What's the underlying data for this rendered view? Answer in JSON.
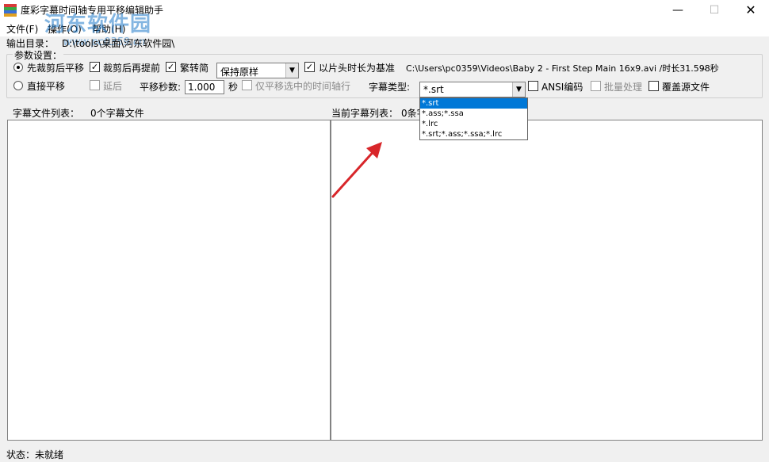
{
  "window": {
    "title": "度彩字幕时间轴专用平移编辑助手",
    "minimize": "—",
    "maximize": "☐",
    "close": "✕"
  },
  "menu": {
    "items": [
      "文件(F)",
      "操作(O)",
      "帮助(H)"
    ]
  },
  "output": {
    "label": "输出目录：",
    "path": "D:\\tools\\桌面\\河东软件园\\"
  },
  "params": {
    "legend": "参数设置：",
    "mode_cut_then_shift": "先裁剪后平移",
    "cut_then_advance": "裁剪后再提前",
    "trad_to_simp": "繁转简",
    "conversion_select": "保持原样",
    "use_head_duration": "以片头时长为基准",
    "video_path": "C:\\Users\\pc0359\\Videos\\Baby 2 - First Step Main 16x9.avi  /时长31.598秒",
    "video_more": "..",
    "mode_direct_shift": "直接平移",
    "delay": "延后",
    "shift_seconds_label": "平移秒数:",
    "shift_seconds_value": "1.000",
    "seconds_unit": "秒",
    "shift_selected_only": "仅平移选中的时间轴行",
    "subtitle_type_label": "字幕类型:",
    "subtitle_type_value": "*.srt",
    "ansi_encoding": "ANSI编码",
    "batch_process": "批量处理",
    "overwrite_source": "覆盖源文件"
  },
  "dropdown": {
    "options": [
      "*.srt",
      "*.ass;*.ssa",
      "*.lrc",
      "*.srt;*.ass;*.ssa;*.lrc"
    ]
  },
  "panels": {
    "left_label": "字幕文件列表：",
    "left_count": "0个字幕文件",
    "right_label": "当前字幕列表：",
    "right_count": "0条字"
  },
  "status": {
    "text": "状态：未就绪"
  },
  "watermark": {
    "text": "河东软件园",
    "url": "www.pc0359.cn"
  },
  "colors": {
    "accent": "#0078d7",
    "arrow": "#d8262a"
  }
}
